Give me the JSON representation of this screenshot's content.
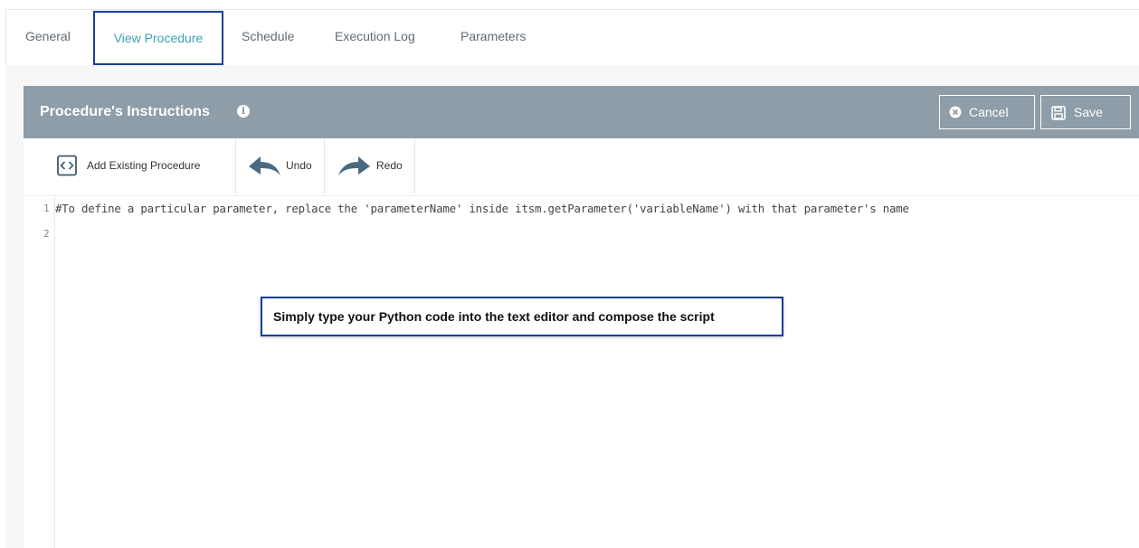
{
  "tabs": [
    {
      "label": "General",
      "active": false
    },
    {
      "label": "View Procedure",
      "active": true
    },
    {
      "label": "Schedule",
      "active": false
    },
    {
      "label": "Execution Log",
      "active": false
    },
    {
      "label": "Parameters",
      "active": false
    }
  ],
  "panel": {
    "title": "Procedure's Instructions",
    "info_icon": "info-icon",
    "cancel_label": "Cancel",
    "save_label": "Save"
  },
  "toolbar": {
    "add_existing_label": "Add Existing Procedure",
    "undo_label": "Undo",
    "redo_label": "Redo"
  },
  "editor": {
    "lines": [
      {
        "number": "1",
        "text": "#To define a particular parameter, replace the 'parameterName' inside itsm.getParameter('variableName') with that parameter's name"
      },
      {
        "number": "2",
        "text": ""
      }
    ]
  },
  "callout": {
    "text": "Simply type your Python code into the text editor and compose the script"
  },
  "colors": {
    "header_bg": "#8e9da7",
    "active_tab_text": "#3aa3b5",
    "highlight_border": "#1b3e9c"
  }
}
